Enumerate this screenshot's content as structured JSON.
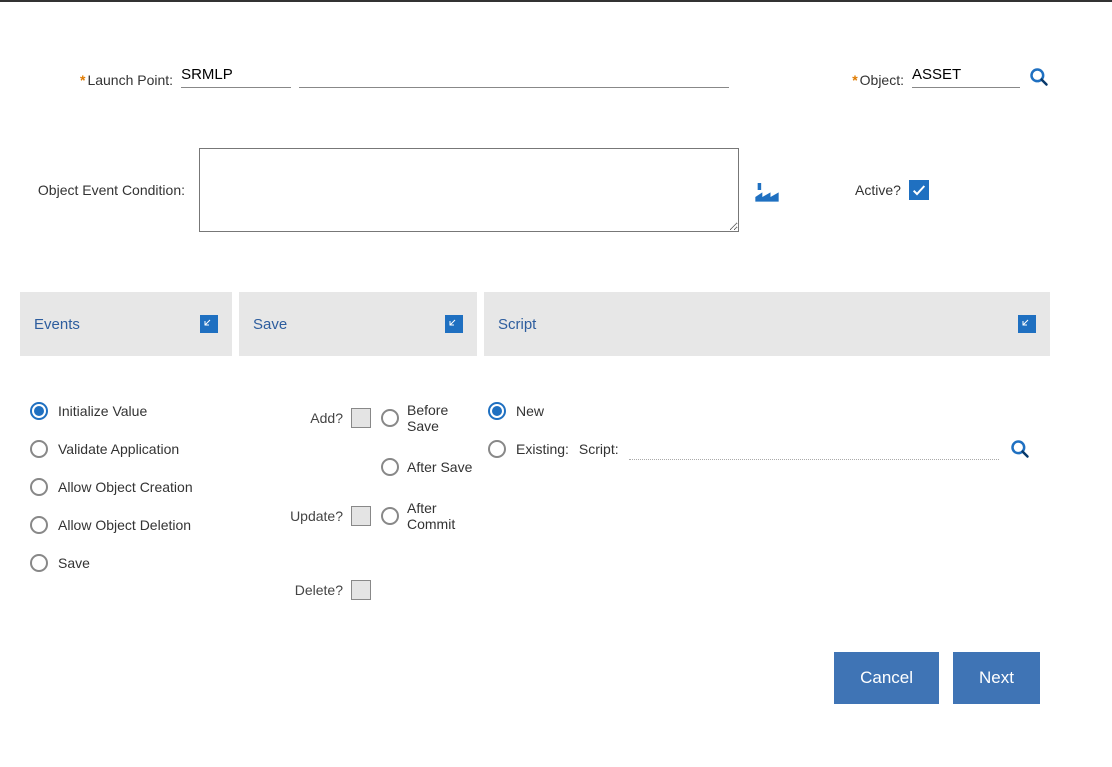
{
  "top": {
    "launch_point_label": "Launch Point:",
    "launch_point_value": "SRMLP",
    "launch_point_desc": "",
    "object_label": "Object:",
    "object_value": "ASSET"
  },
  "condition": {
    "label": "Object Event Condition:",
    "value": "",
    "active_label": "Active?",
    "active_checked": true
  },
  "sections": {
    "events_title": "Events",
    "save_title": "Save",
    "script_title": "Script"
  },
  "events": {
    "options": [
      {
        "label": "Initialize Value",
        "selected": true
      },
      {
        "label": "Validate Application",
        "selected": false
      },
      {
        "label": "Allow Object Creation",
        "selected": false
      },
      {
        "label": "Allow Object Deletion",
        "selected": false
      },
      {
        "label": "Save",
        "selected": false
      }
    ]
  },
  "save": {
    "add_label": "Add?",
    "update_label": "Update?",
    "delete_label": "Delete?",
    "before_label": "Before Save",
    "after_label": "After Save",
    "aftercommit_label": "After Commit",
    "add_checked": false,
    "update_checked": false,
    "delete_checked": false,
    "timing_selected": ""
  },
  "script": {
    "new_label": "New",
    "existing_label": "Existing:",
    "mode_selected": "new",
    "script_field_label": "Script:",
    "script_value": ""
  },
  "footer": {
    "cancel_label": "Cancel",
    "next_label": "Next"
  },
  "icons": {
    "search": "search-icon",
    "builder": "condition-builder-icon",
    "collapse": "collapse-icon"
  }
}
